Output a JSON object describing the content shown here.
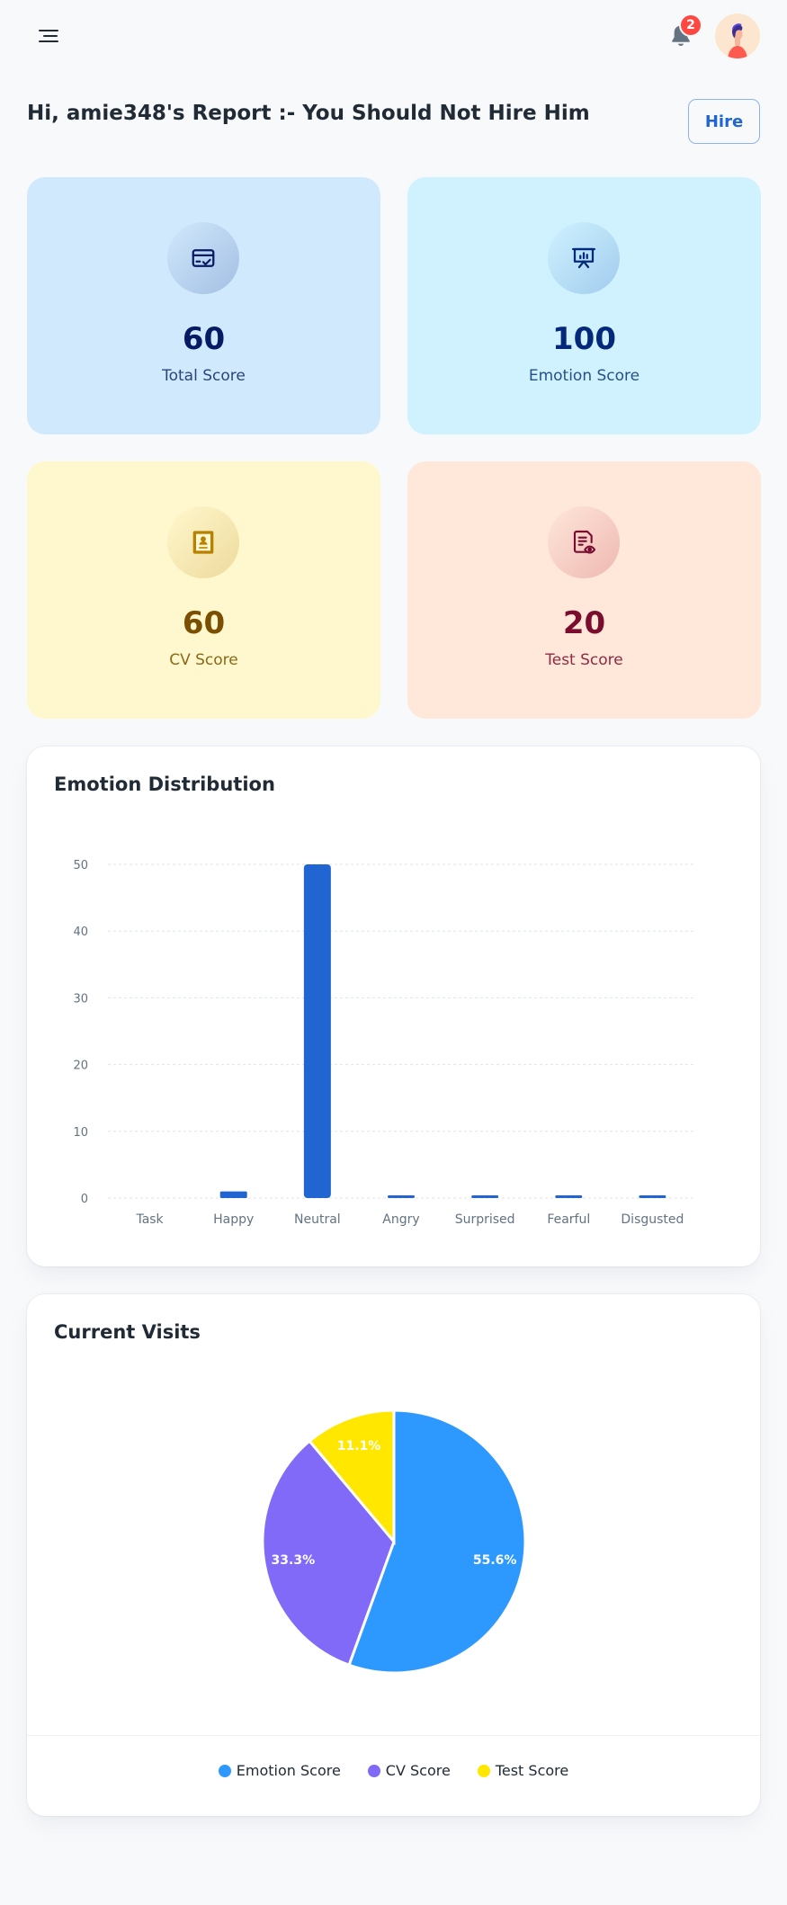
{
  "header": {
    "notification_count": "2"
  },
  "page": {
    "title": "Hi, amie348's Report :- You Should Not Hire Him",
    "hire_label": "Hire"
  },
  "cards": [
    {
      "value": "60",
      "label": "Total Score",
      "icon": "credit-card-check-icon"
    },
    {
      "value": "100",
      "label": "Emotion Score",
      "icon": "presentation-chart-icon"
    },
    {
      "value": "60",
      "label": "CV Score",
      "icon": "contact-book-icon"
    },
    {
      "value": "20",
      "label": "Test Score",
      "icon": "document-eye-icon"
    }
  ],
  "emotion_panel": {
    "title": "Emotion Distribution"
  },
  "visits_panel": {
    "title": "Current Visits"
  },
  "chart_data": [
    {
      "type": "bar",
      "title": "Emotion Distribution",
      "categories": [
        "Task",
        "Happy",
        "Neutral",
        "Angry",
        "Surprised",
        "Fearful",
        "Disgusted"
      ],
      "values": [
        0,
        1,
        50,
        0,
        0,
        0,
        0
      ],
      "ylim": [
        0,
        50
      ],
      "yticks": [
        0,
        10,
        20,
        30,
        40,
        50
      ],
      "grid": true,
      "color": "#2065d1"
    },
    {
      "type": "pie",
      "title": "Current Visits",
      "labels": [
        "Emotion Score",
        "CV Score",
        "Test Score"
      ],
      "values": [
        100,
        60,
        20
      ],
      "percent_labels": [
        "55.6%",
        "33.3%",
        "11.1%"
      ],
      "colors": [
        "#2d99ff",
        "#826af9",
        "#ffe700"
      ],
      "legend": "bottom"
    }
  ]
}
